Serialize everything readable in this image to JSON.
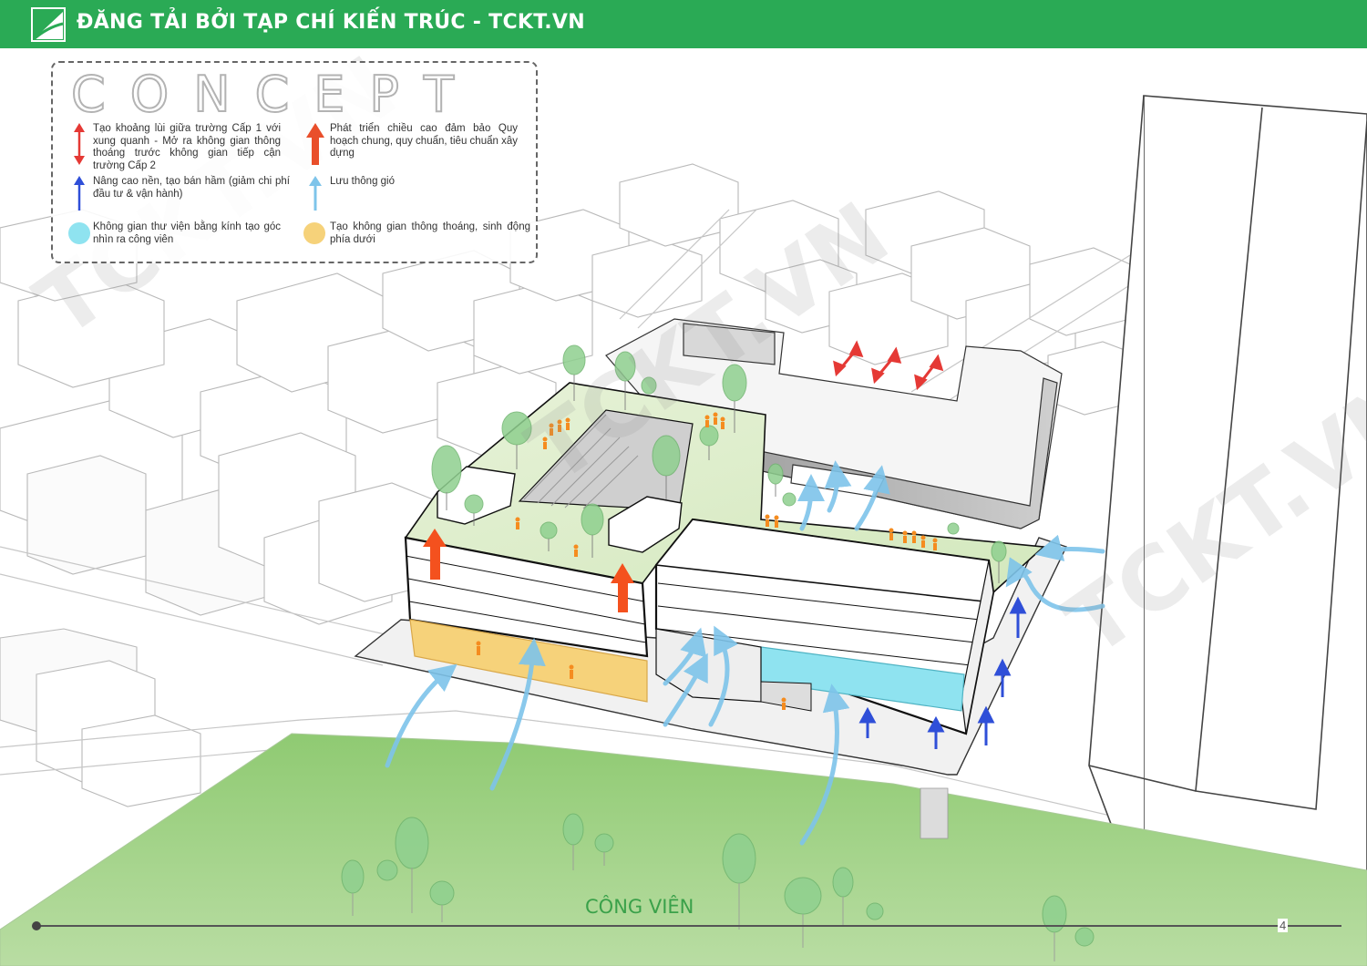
{
  "header": {
    "title": "ĐĂNG TẢI BỞI TẠP CHÍ KIẾN TRÚC - TCKT.VN",
    "logo_icon": "architecture-magazine-logo-icon"
  },
  "legend": {
    "title": "CONCEPT",
    "items": [
      {
        "text": "Tạo khoảng lùi giữa trường Cấp 1 với xung quanh - Mở ra không gian thông thoáng trước không gian tiếp cận trường Cấp 2",
        "icon": "double-red-arrow-icon"
      },
      {
        "text": "Phát triển chiều cao đảm bảo Quy hoạch chung, quy chuẩn, tiêu chuẩn xây dựng",
        "icon": "orange-up-arrow-icon"
      },
      {
        "text": "Nâng cao nền, tạo bán hầm (giảm chi phí đầu tư & vận hành)",
        "icon": "blue-up-arrow-icon"
      },
      {
        "text": "Lưu thông gió",
        "icon": "light-blue-arrow-icon"
      },
      {
        "text": "Không gian thư viện bằng kính tạo góc nhìn ra công viên",
        "icon": "cyan-circle-icon"
      },
      {
        "text": "Tạo không gian thông thoáng, sinh động phía dưới",
        "icon": "yellow-circle-icon"
      }
    ]
  },
  "park_label": "CÔNG VIÊN",
  "page_number": "4",
  "watermark": "TCKT.VN",
  "colors": {
    "banner": "#2aaa55",
    "park": "#8fca72",
    "roof_garden": "#dcedc8",
    "red_arrow": "#e53935",
    "orange_arrow": "#f4511e",
    "blue_arrow": "#2f4fd8",
    "wind_arrow": "#7ec4ea",
    "glass_library": "#8fe3f0",
    "open_ground": "#f6d27a",
    "people": "#f58c1f",
    "tree": "#8fd08f"
  }
}
